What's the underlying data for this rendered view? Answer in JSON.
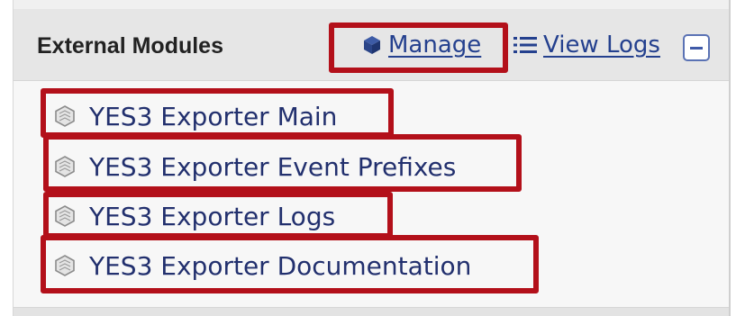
{
  "panel": {
    "title": "External Modules",
    "manage": {
      "label": "Manage",
      "icon": "cube-icon"
    },
    "view_logs": {
      "label": "View Logs",
      "icon": "list-icon"
    },
    "collapse": {
      "icon": "minus-icon"
    }
  },
  "modules": [
    {
      "label": "YES3 Exporter Main",
      "icon": "module-icon"
    },
    {
      "label": "YES3 Exporter Event Prefixes",
      "icon": "module-icon"
    },
    {
      "label": "YES3 Exporter Logs",
      "icon": "module-icon"
    },
    {
      "label": "YES3 Exporter Documentation",
      "icon": "module-icon"
    }
  ],
  "colors": {
    "link": "#24408e",
    "module_text": "#22306e",
    "highlight": "#b3101a",
    "header_bg": "#e6e6e6"
  }
}
